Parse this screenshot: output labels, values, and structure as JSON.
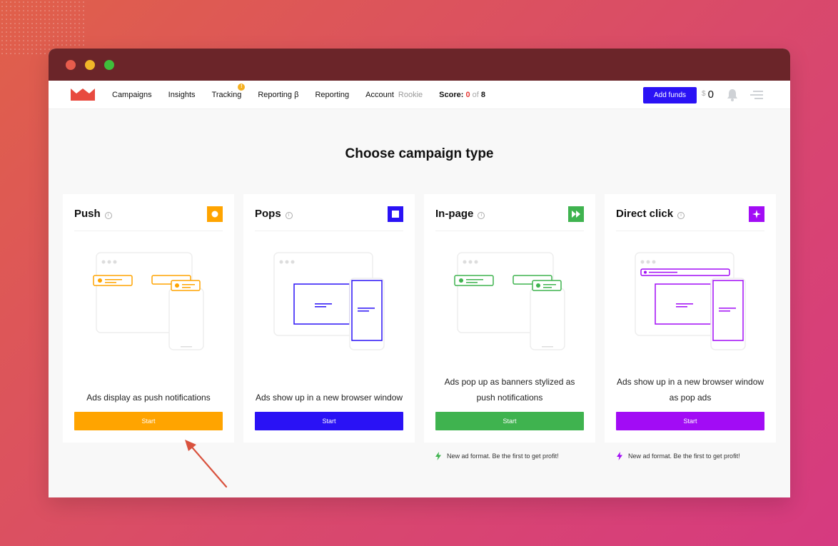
{
  "nav": {
    "links": [
      "Campaigns",
      "Insights",
      "Tracking",
      "Reporting β",
      "Reporting",
      "Account"
    ],
    "account_level": "Rookie",
    "tracking_badge": "!",
    "score_label": "Score:",
    "score_value": "0",
    "score_of": "of",
    "score_total": "8",
    "add_funds": "Add funds",
    "currency": "$",
    "balance": "0"
  },
  "heading": "Choose campaign type",
  "cards": [
    {
      "title": "Push",
      "description": "Ads display as push notifications",
      "button": "Start",
      "color": "#ffa400"
    },
    {
      "title": "Pops",
      "description": "Ads show up in a new browser window",
      "button": "Start",
      "color": "#2a12f5"
    },
    {
      "title": "In-page",
      "description": "Ads pop up as banners stylized as push notifications",
      "button": "Start",
      "color": "#3fb34f"
    },
    {
      "title": "Direct click",
      "description": "Ads show up in a new browser window as pop ads",
      "button": "Start",
      "color": "#a20cf5"
    }
  ],
  "notes": [
    {
      "text": "New ad format. Be the first to get profit!",
      "color": "#3fb34f"
    },
    {
      "text": "New ad format. Be the first to get profit!",
      "color": "#a20cf5"
    }
  ],
  "icons": {
    "info": "i",
    "push": "circle-icon",
    "pops": "square-icon",
    "inpage": "fast-forward-icon",
    "direct": "sparkle-icon",
    "bell": "bell-icon",
    "menu": "menu-icon",
    "lightning": "lightning-icon"
  },
  "colors": {
    "titlebar": "#6b2529",
    "primary": "#2a12f5",
    "score_value": "#e53935"
  }
}
